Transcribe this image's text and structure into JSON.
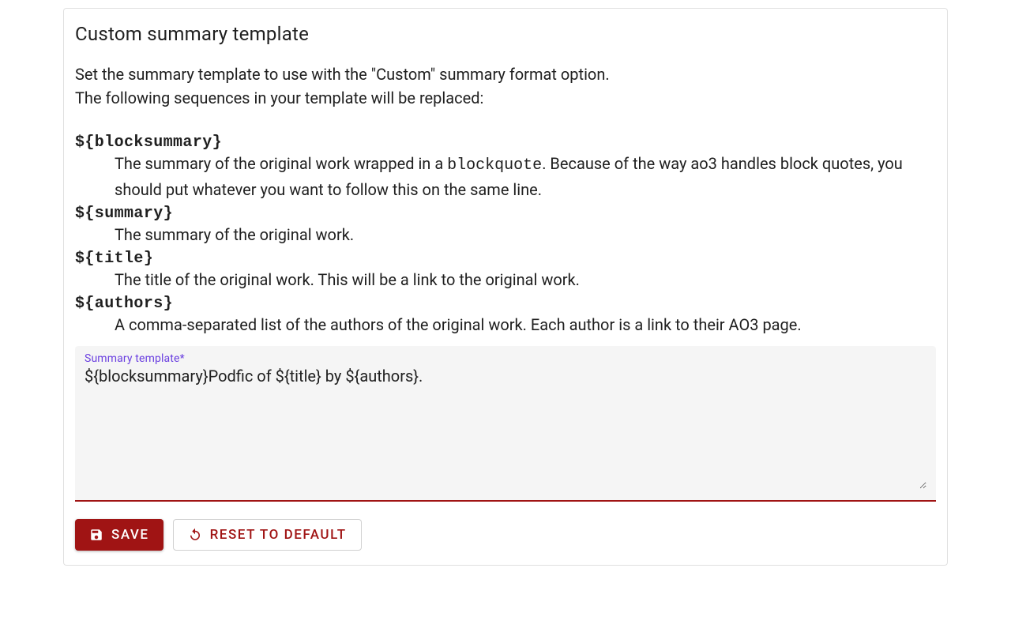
{
  "card": {
    "title": "Custom summary template",
    "intro_line1": "Set the summary template to use with the \"Custom\" summary format option.",
    "intro_line2": "The following sequences in your template will be replaced:"
  },
  "sequences": [
    {
      "token": "${blocksummary}",
      "desc_pre": "The summary of the original work wrapped in a ",
      "desc_code": "blockquote",
      "desc_post": ". Because of the way ao3 handles block quotes, you should put whatever you want to follow this on the same line."
    },
    {
      "token": "${summary}",
      "desc_pre": "The summary of the original work.",
      "desc_code": "",
      "desc_post": ""
    },
    {
      "token": "${title}",
      "desc_pre": "The title of the original work. This will be a link to the original work.",
      "desc_code": "",
      "desc_post": ""
    },
    {
      "token": "${authors}",
      "desc_pre": "A comma-separated list of the authors of the original work. Each author is a link to their AO3 page.",
      "desc_code": "",
      "desc_post": ""
    }
  ],
  "field": {
    "label": "Summary template*",
    "value": "${blocksummary}Podfic of ${title} by ${authors}."
  },
  "buttons": {
    "save": "Save",
    "reset": "Reset to default"
  }
}
